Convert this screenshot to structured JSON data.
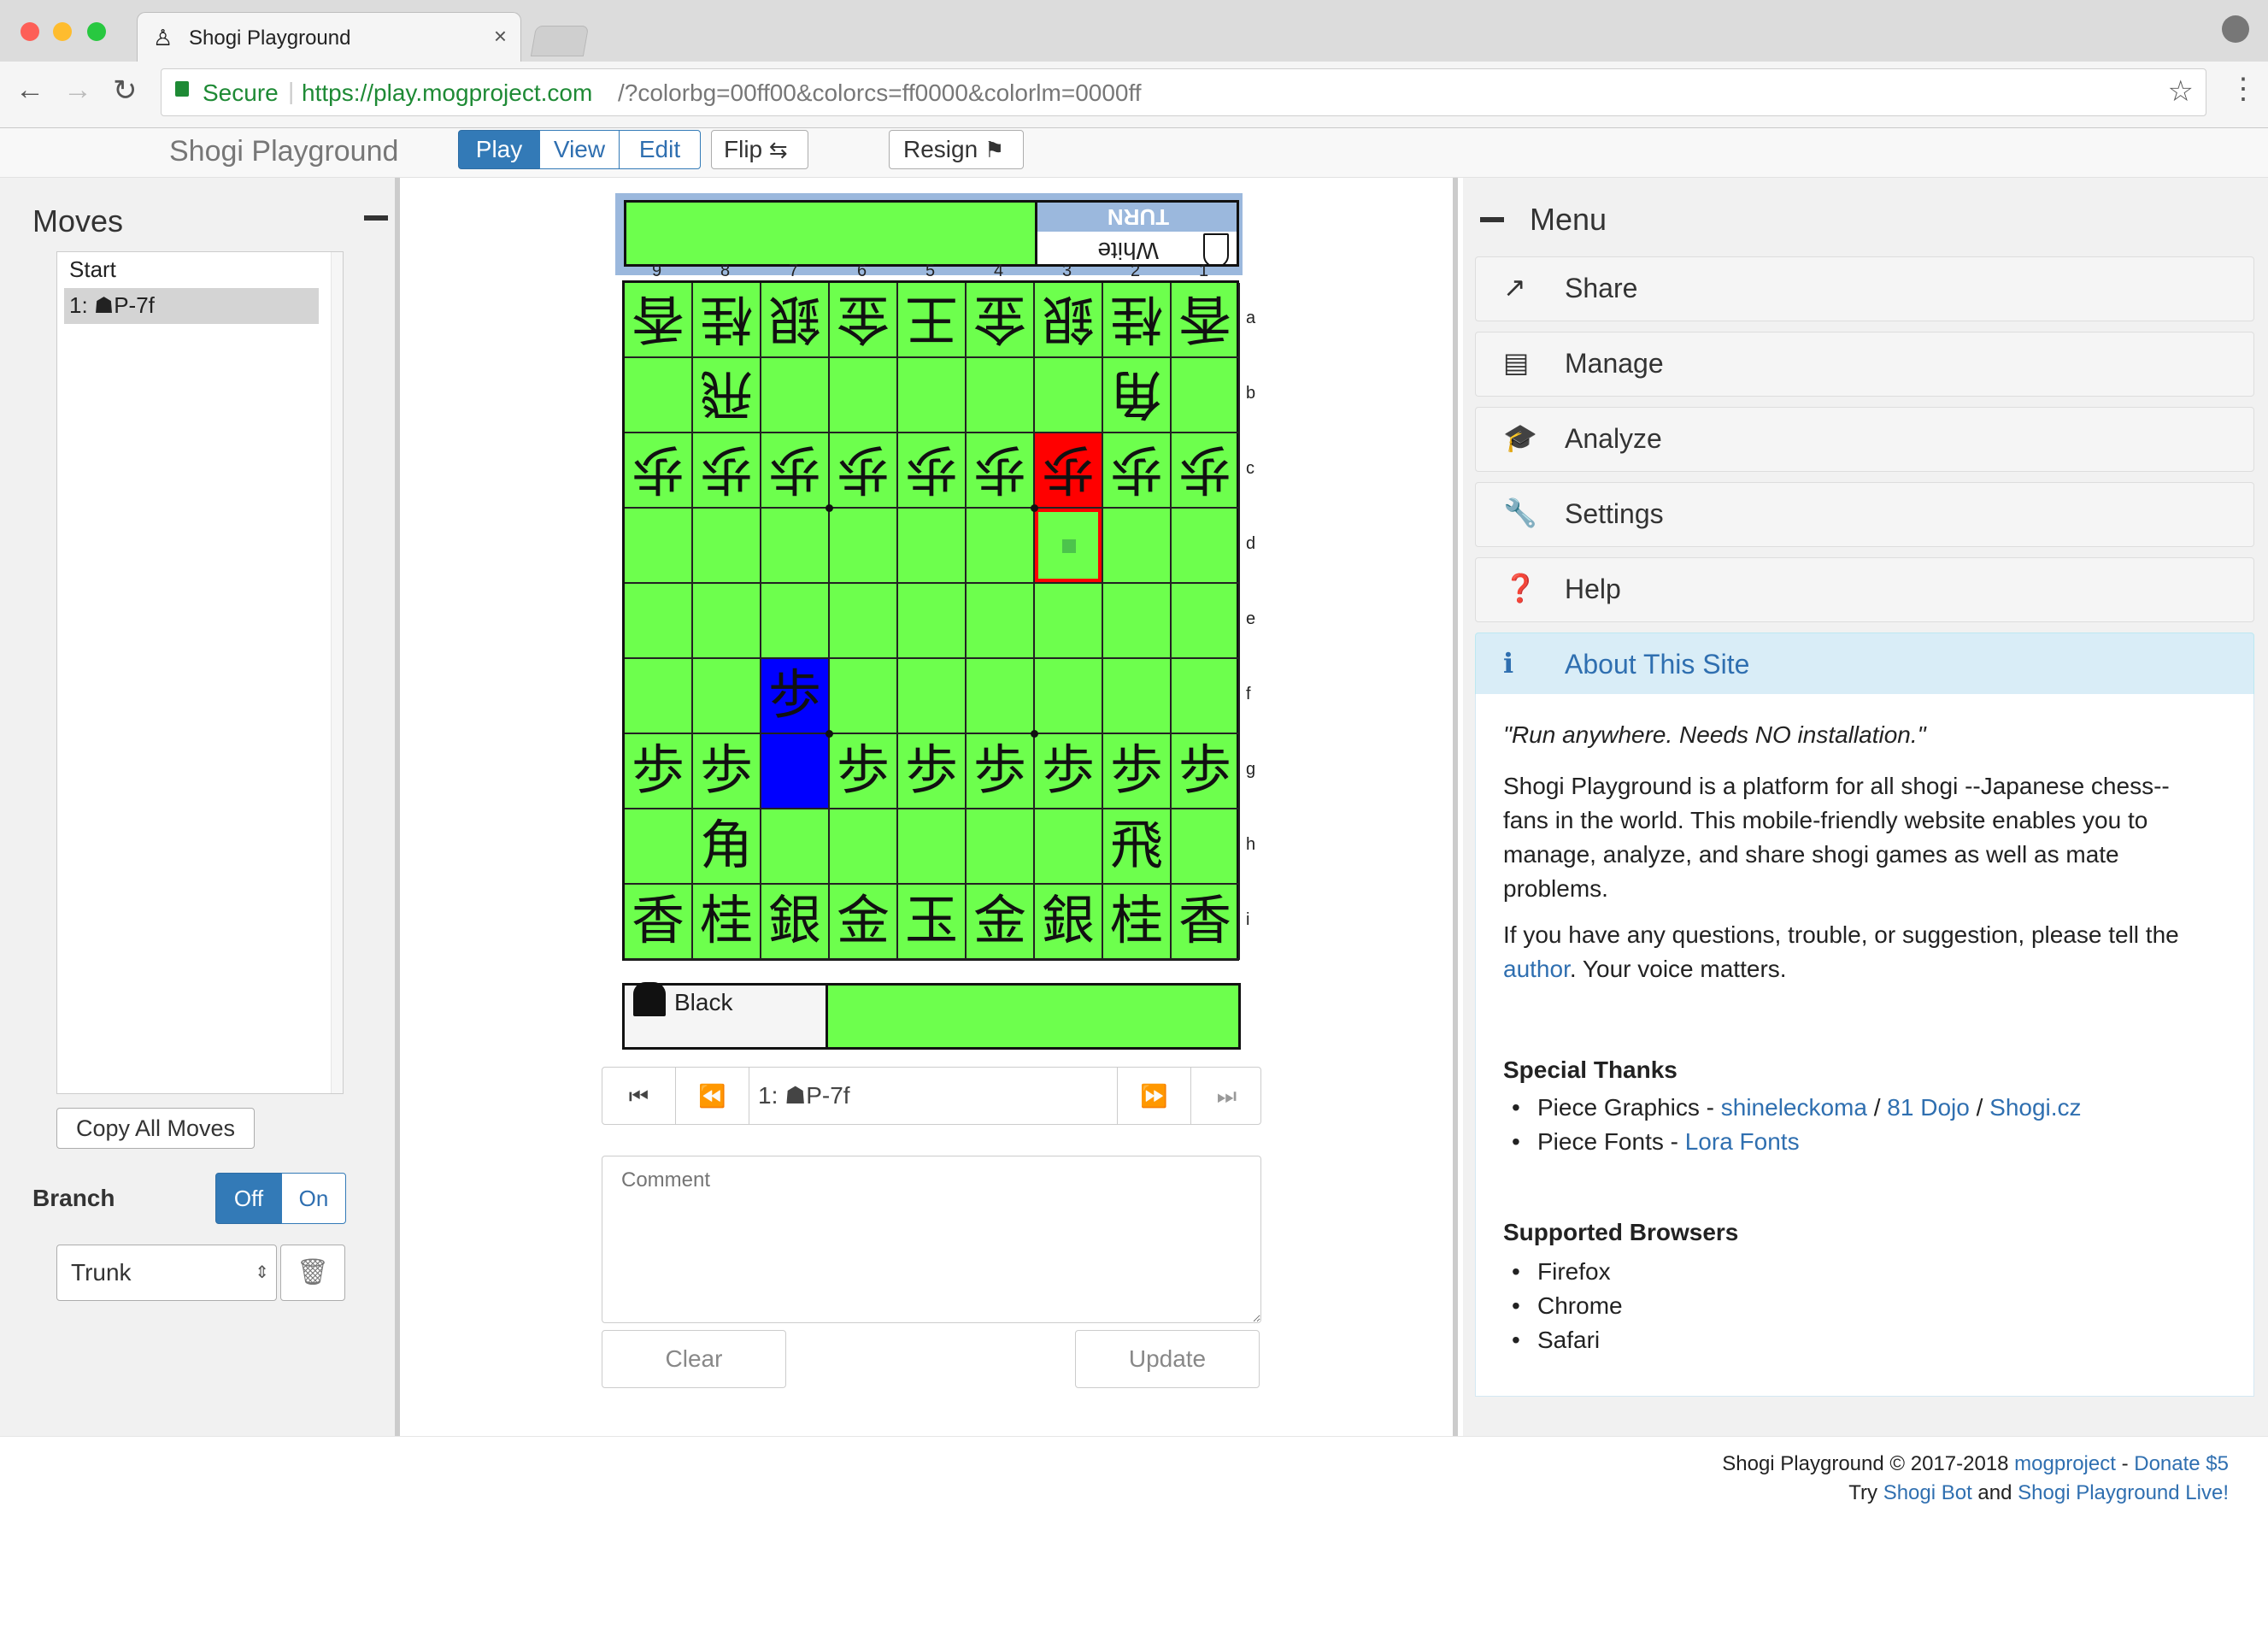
{
  "browser": {
    "tab_title": "Shogi Playground",
    "tab_close": "×",
    "secure_label": "Secure",
    "url_base": "https://play.mogproject.com",
    "url_query": "/?colorbg=00ff00&colorcs=ff0000&colorlm=0000ff"
  },
  "navbar": {
    "brand": "Shogi Playground",
    "modes": [
      "Play",
      "View",
      "Edit"
    ],
    "active_mode": "Play",
    "flip_label": "Flip",
    "resign_label": "Resign"
  },
  "moves_panel": {
    "title": "Moves",
    "collapse": "−",
    "moves": [
      "Start",
      "1: ☗P-7f"
    ],
    "selected_index": 1,
    "copy_button": "Copy All Moves",
    "branch_label": "Branch",
    "branch_off": "Off",
    "branch_on": "On",
    "branch_selected": "Off",
    "branch_select_value": "Trunk"
  },
  "board": {
    "colors": {
      "background": "#6dff4d",
      "last_move": "#0000ff",
      "cursor": "#ff0000"
    },
    "white_player": "White",
    "turn_label": "TURN",
    "black_player": "Black",
    "files": [
      "9",
      "8",
      "7",
      "6",
      "5",
      "4",
      "3",
      "2",
      "1"
    ],
    "ranks": [
      "a",
      "b",
      "c",
      "d",
      "e",
      "f",
      "g",
      "h",
      "i"
    ],
    "pieces_rank_a": [
      "香",
      "桂",
      "銀",
      "金",
      "王",
      "金",
      "銀",
      "桂",
      "香"
    ],
    "pieces_rank_b": [
      "",
      "飛",
      "",
      "",
      "",
      "",
      "",
      "角",
      ""
    ],
    "pieces_rank_c": [
      "歩",
      "歩",
      "歩",
      "歩",
      "歩",
      "歩",
      "歩",
      "歩",
      "歩"
    ],
    "pieces_rank_f": [
      "",
      "",
      "歩",
      "",
      "",
      "",
      "",
      "",
      ""
    ],
    "pieces_rank_g": [
      "歩",
      "歩",
      "",
      "歩",
      "歩",
      "歩",
      "歩",
      "歩",
      "歩"
    ],
    "pieces_rank_h": [
      "",
      "角",
      "",
      "",
      "",
      "",
      "",
      "飛",
      ""
    ],
    "pieces_rank_i": [
      "香",
      "桂",
      "銀",
      "金",
      "玉",
      "金",
      "銀",
      "桂",
      "香"
    ]
  },
  "controls": {
    "current_move": "1: ☗P-7f",
    "comment_placeholder": "Comment",
    "clear_button": "Clear",
    "update_button": "Update"
  },
  "menu": {
    "title": "Menu",
    "collapse": "−",
    "items": [
      "Share",
      "Manage",
      "Analyze",
      "Settings",
      "Help"
    ],
    "about_title": "About This Site",
    "quote": "\"Run anywhere. Needs NO installation.\"",
    "intro": "Shogi Playground is a platform for all shogi --Japanese chess-- fans in the world. This mobile-friendly website enables you to manage, analyze, and share shogi games as well as mate problems.",
    "contact_prefix": "If you have any questions, trouble, or suggestion, please tell the",
    "contact_link": "author",
    "contact_suffix": ". Your voice matters.",
    "thanks_title": "Special Thanks",
    "graphics_label": "Piece Graphics - ",
    "graphics_links": [
      "shineleckoma",
      "81 Dojo",
      "Shogi.cz"
    ],
    "slash": " / ",
    "fonts_label": "Piece Fonts - ",
    "fonts_link": "Lora Fonts",
    "browsers_title": "Supported Browsers",
    "browsers": [
      "Firefox",
      "Chrome",
      "Safari"
    ]
  },
  "footer": {
    "copyright": "Shogi Playground © 2017-2018 ",
    "author_link": "mogproject",
    "dash": " - ",
    "donate_link": "Donate $5",
    "try_prefix": "Try ",
    "bot_link": "Shogi Bot",
    "and": " and ",
    "live_link": "Shogi Playground Live!"
  }
}
